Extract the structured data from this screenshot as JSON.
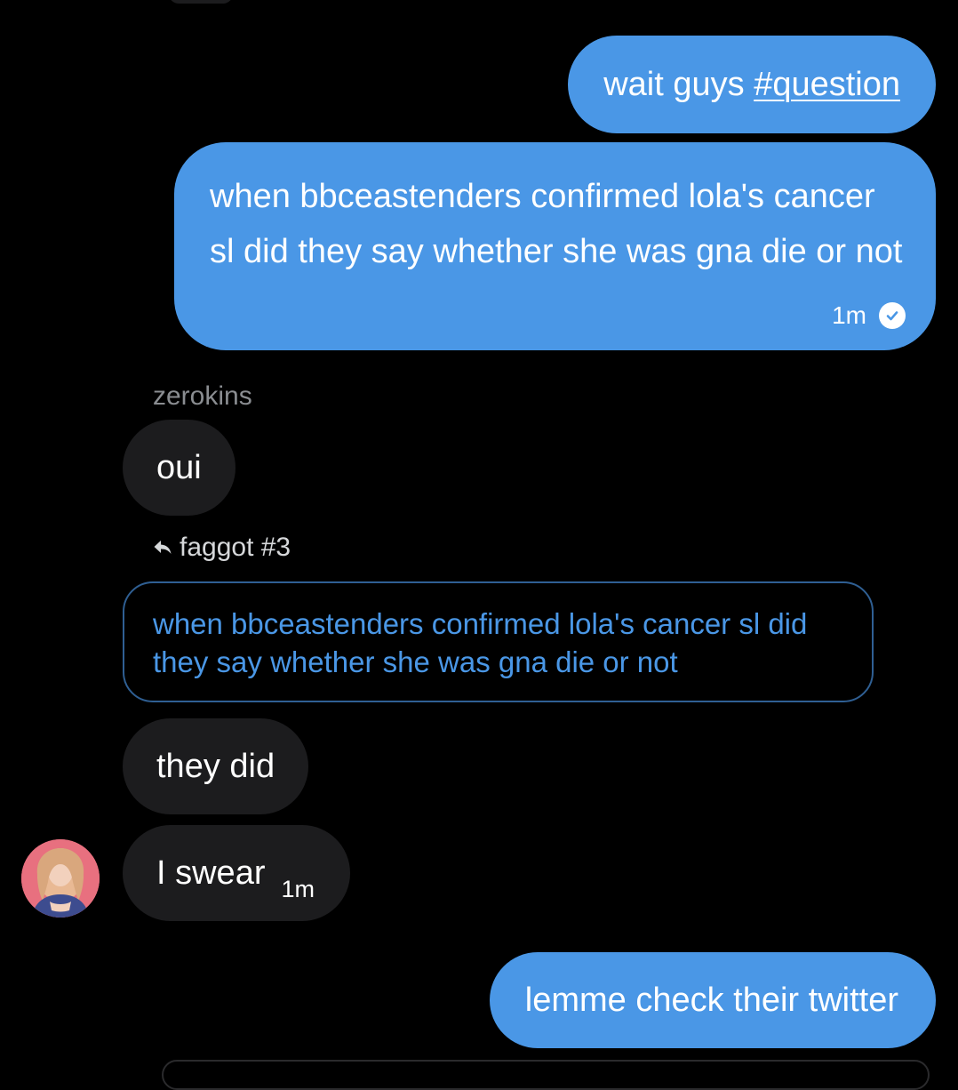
{
  "conversation": {
    "messages": [
      {
        "direction": "outgoing",
        "text_plain": "wait guys ",
        "hashtag": "#question"
      },
      {
        "direction": "outgoing",
        "text": "when bbceastenders confirmed lola's cancer sl did they say whether she was gna die or not",
        "time": "1m",
        "status_icon": "read-check-icon"
      },
      {
        "direction": "incoming",
        "sender": "zerokins",
        "text": "oui"
      },
      {
        "direction": "incoming",
        "reply_to": "faggot #3",
        "quote": "when bbceastenders confirmed lola's cancer sl did they say whether she was gna die or not",
        "text": "they did",
        "reply_icon": "reply-arrow-icon"
      },
      {
        "direction": "incoming",
        "text": "I swear",
        "time": "1m",
        "avatar": "avatar-image"
      },
      {
        "direction": "outgoing",
        "text": "lemme check their twitter"
      }
    ]
  },
  "colors": {
    "background": "#000000",
    "outgoing_bubble": "#4a97e6",
    "incoming_bubble": "#1c1c1e",
    "sender_name": "#8a8d91",
    "quote_text": "#4a97e6",
    "quote_border": "#2f5f93"
  }
}
